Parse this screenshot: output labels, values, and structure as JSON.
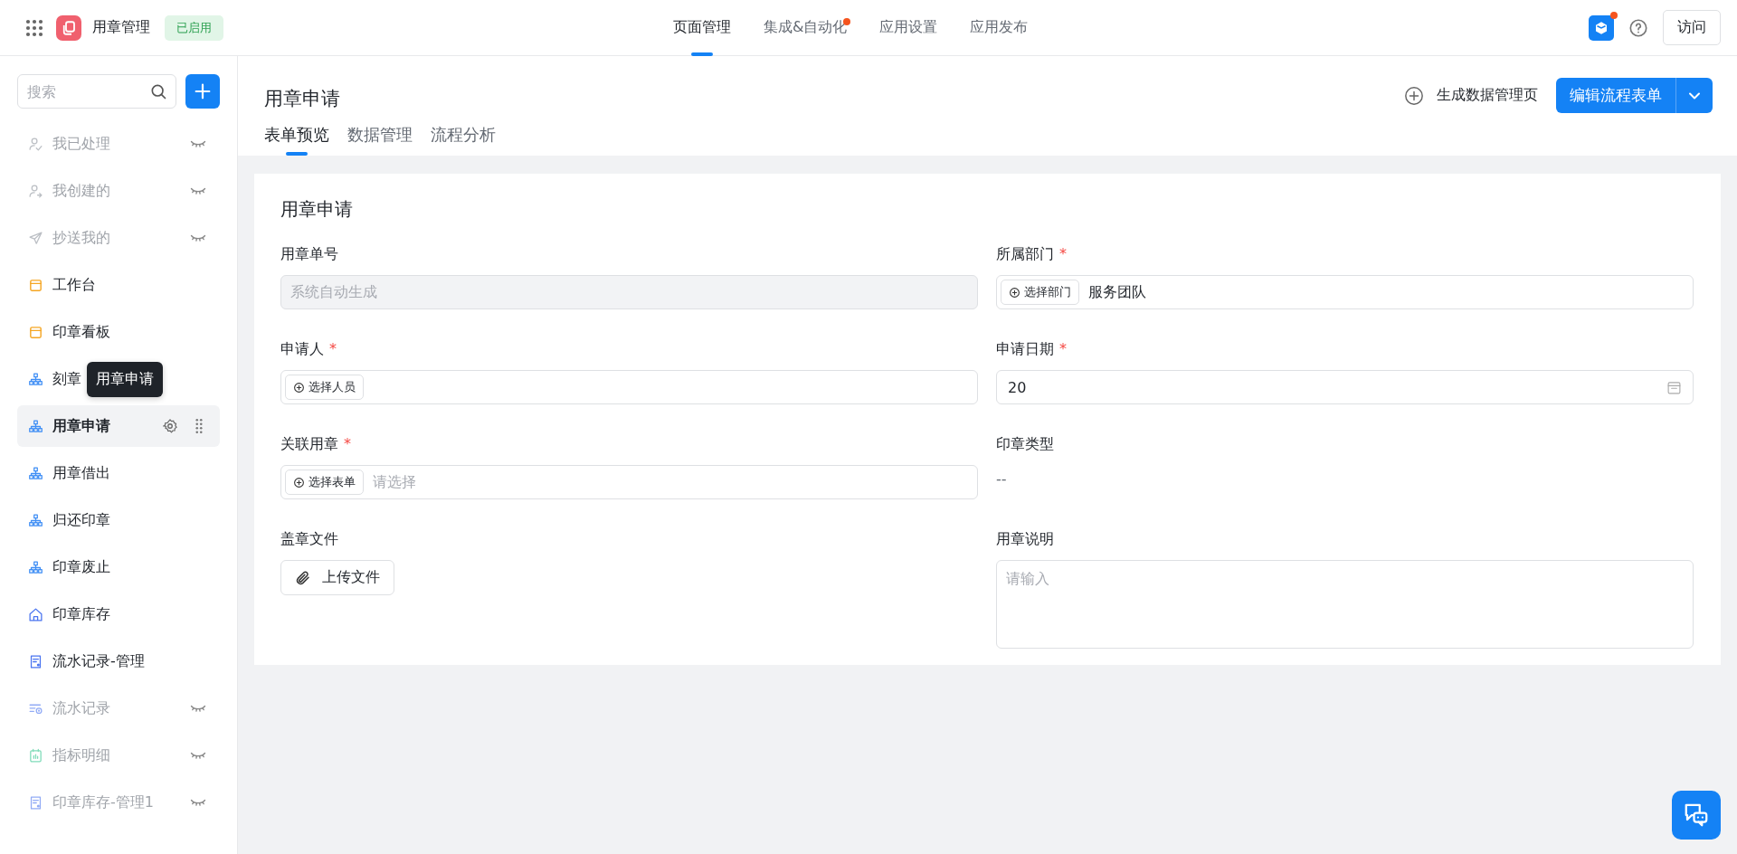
{
  "app": {
    "name": "用章管理",
    "status": "已启用"
  },
  "nav_tabs": [
    {
      "label": "页面管理",
      "selected": true,
      "dot": false
    },
    {
      "label": "集成&自动化",
      "selected": false,
      "dot": true
    },
    {
      "label": "应用设置",
      "selected": false,
      "dot": false
    },
    {
      "label": "应用发布",
      "selected": false,
      "dot": false
    }
  ],
  "top_actions": {
    "notify_dot": true,
    "visit": "访问"
  },
  "sidebar": {
    "search_placeholder": "搜索",
    "items": [
      {
        "label": "我已处理",
        "kind": "processed",
        "hidden": true,
        "selected": false
      },
      {
        "label": "我创建的",
        "kind": "created",
        "hidden": true,
        "selected": false
      },
      {
        "label": "抄送我的",
        "kind": "cc",
        "hidden": true,
        "selected": false
      },
      {
        "label": "工作台",
        "kind": "dashboard",
        "hidden": false,
        "selected": false
      },
      {
        "label": "印章看板",
        "kind": "dashboard",
        "hidden": false,
        "selected": false
      },
      {
        "label": "刻章",
        "kind": "flow",
        "hidden": false,
        "selected": false
      },
      {
        "label": "用章申请",
        "kind": "flow",
        "hidden": false,
        "selected": true
      },
      {
        "label": "用章借出",
        "kind": "flow",
        "hidden": false,
        "selected": false
      },
      {
        "label": "归还印章",
        "kind": "flow",
        "hidden": false,
        "selected": false
      },
      {
        "label": "印章废止",
        "kind": "flow",
        "hidden": false,
        "selected": false
      },
      {
        "label": "印章库存",
        "kind": "home",
        "hidden": false,
        "selected": false
      },
      {
        "label": "流水记录-管理",
        "kind": "report",
        "hidden": false,
        "selected": false
      },
      {
        "label": "流水记录",
        "kind": "list",
        "hidden": true,
        "selected": false
      },
      {
        "label": "指标明细",
        "kind": "chart",
        "hidden": true,
        "selected": false
      },
      {
        "label": "印章库存-管理1",
        "kind": "report",
        "hidden": true,
        "selected": false
      }
    ],
    "tooltip": "用章申请"
  },
  "page": {
    "title": "用章申请",
    "generate": "生成数据管理页",
    "edit_button": "编辑流程表单",
    "tabs": [
      {
        "label": "表单预览",
        "selected": true
      },
      {
        "label": "数据管理",
        "selected": false
      },
      {
        "label": "流程分析",
        "selected": false
      }
    ]
  },
  "form": {
    "title": "用章申请",
    "fields": [
      {
        "label": "用章单号",
        "kind": "text",
        "placeholder": "系统自动生成",
        "disabled": true
      },
      {
        "label": "所属部门",
        "required_mark": "*",
        "kind": "picker",
        "button": "选择部门",
        "value": "服务团队"
      },
      {
        "label": "申请人",
        "required_mark": "*",
        "kind": "picker",
        "button": "选择人员"
      },
      {
        "label": "申请日期",
        "required_mark": "*",
        "kind": "date",
        "value": "20"
      },
      {
        "label": "关联用章",
        "required_mark": "*",
        "kind": "picker",
        "button": "选择表单",
        "placeholder": "请选择"
      },
      {
        "label": "印章类型",
        "kind": "readonly",
        "value": "--"
      },
      {
        "label": "盖章文件",
        "kind": "upload",
        "button": "上传文件"
      },
      {
        "label": "用章说明",
        "kind": "textarea",
        "placeholder": "请输入"
      }
    ]
  }
}
